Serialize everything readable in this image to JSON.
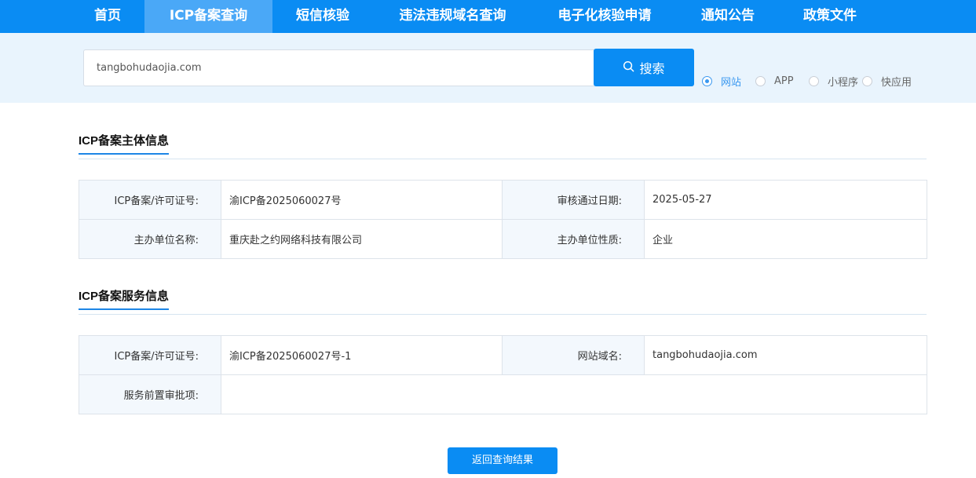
{
  "nav": {
    "items": [
      {
        "label": "首页"
      },
      {
        "label": "ICP备案查询"
      },
      {
        "label": "短信核验"
      },
      {
        "label": "违法违规域名查询"
      },
      {
        "label": "电子化核验申请"
      },
      {
        "label": "通知公告"
      },
      {
        "label": "政策文件"
      }
    ],
    "active_index": 1
  },
  "search": {
    "value": "tangbohudaojia.com",
    "button_label": "搜索",
    "options": [
      {
        "label": "网站",
        "checked": true
      },
      {
        "label": "APP",
        "checked": false
      },
      {
        "label": "小程序",
        "checked": false
      },
      {
        "label": "快应用",
        "checked": false
      }
    ]
  },
  "subject_info": {
    "title": "ICP备案主体信息",
    "rows": [
      {
        "label1": "ICP备案/许可证号:",
        "value1": "渝ICP备2025060027号",
        "label2": "审核通过日期:",
        "value2": "2025-05-27"
      },
      {
        "label1": "主办单位名称:",
        "value1": "重庆赴之约网络科技有限公司",
        "label2": "主办单位性质:",
        "value2": "企业"
      }
    ]
  },
  "service_info": {
    "title": "ICP备案服务信息",
    "row1": {
      "label1": "ICP备案/许可证号:",
      "value1": "渝ICP备2025060027号-1",
      "label2": "网站域名:",
      "value2": "tangbohudaojia.com"
    },
    "row2": {
      "label": "服务前置审批项:",
      "value": ""
    }
  },
  "back_button": {
    "label": "返回查询结果"
  },
  "colors": {
    "primary": "#0a8cf3",
    "nav_active": "#4aa8f7",
    "band": "#e9f4fd"
  }
}
